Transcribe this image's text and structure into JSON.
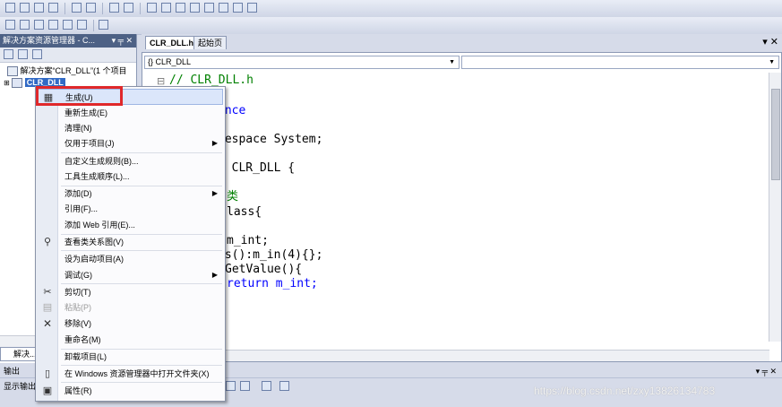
{
  "solution_explorer": {
    "title": "解决方案资源管理器 - C...",
    "title_controls": "▾ ╤ ✕",
    "solution_node": "解决方案“CLR_DLL”(1 个项目",
    "project_node": "CLR_DLL",
    "bottom_tab": "解决..."
  },
  "editor": {
    "tab_active": "CLR_DLL.h",
    "tab_inactive": "起始页",
    "close_glyph": "▾ ✕",
    "scope_combo": "{} CLR_DLL",
    "collapse_glyph": "⊟",
    "code_lines": [
      "// CLR_DLL.h",
      "",
      "once",
      "",
      "mespace System;",
      "",
      "e CLR_DLL {",
      "",
      "类",
      "lass{",
      "",
      "m_int;",
      "ss():m_in(4){};",
      "GetValue(){",
      "return m_int;"
    ]
  },
  "output_panel": {
    "title": "输出",
    "controls": "▾ ╤ ✕",
    "show_label": "显示输出"
  },
  "context_menu": {
    "items": [
      {
        "label": "生成(U)",
        "icon": "build-icon"
      },
      {
        "label": "重新生成(E)"
      },
      {
        "label": "清理(N)"
      },
      {
        "label": "仅用于项目(J)",
        "submenu": true
      },
      {
        "label": "自定义生成规则(B)..."
      },
      {
        "label": "工具生成顺序(L)..."
      },
      {
        "label": "添加(D)",
        "submenu": true
      },
      {
        "label": "引用(F)..."
      },
      {
        "label": "添加 Web 引用(E)..."
      },
      {
        "label": "查看类关系图(V)",
        "icon": "class-diagram-icon"
      },
      {
        "label": "设为启动项目(A)"
      },
      {
        "label": "调试(G)",
        "submenu": true
      },
      {
        "label": "剪切(T)",
        "icon": "scissors-icon"
      },
      {
        "label": "粘贴(P)",
        "icon": "paste-icon",
        "disabled": true
      },
      {
        "label": "移除(V)",
        "icon": "remove-icon"
      },
      {
        "label": "重命名(M)"
      },
      {
        "label": "卸载项目(L)"
      },
      {
        "label": "在 Windows 资源管理器中打开文件夹(X)",
        "icon": "folder-open-icon"
      },
      {
        "label": "属性(R)",
        "icon": "properties-icon"
      }
    ]
  },
  "watermark": "https://blog.csdn.net/zxy13826134783",
  "colors": {
    "highlight_box": "#e0282a",
    "keyword": "#0000ff",
    "comment": "#008000",
    "panel_title": "#4d6185"
  }
}
